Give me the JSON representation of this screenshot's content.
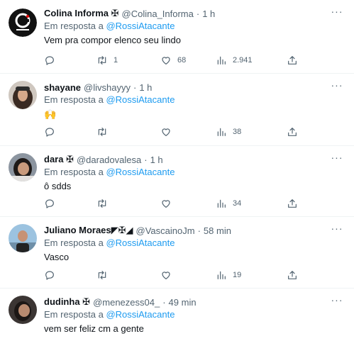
{
  "replies": [
    {
      "name": "Colina Informa ✠",
      "handle": "@Colina_Informa",
      "time": "1 h",
      "replying_prefix": "Em resposta a ",
      "replying_to": "@RossiAtacante",
      "text": "Vem pra compor elenco seu lindo",
      "retweets": "1",
      "likes": "68",
      "views": "2.941",
      "replies_count": ""
    },
    {
      "name": "shayane",
      "handle": "@livshayyy",
      "time": "1 h",
      "replying_prefix": "Em resposta a ",
      "replying_to": "@RossiAtacante",
      "text": "🙌",
      "retweets": "",
      "likes": "",
      "views": "38",
      "replies_count": ""
    },
    {
      "name": "dara ✠",
      "handle": "@daradovalesa",
      "time": "1 h",
      "replying_prefix": "Em resposta a ",
      "replying_to": "@RossiAtacante",
      "text": "ô sdds",
      "retweets": "",
      "likes": "",
      "views": "34",
      "replies_count": ""
    },
    {
      "name": "Juliano Moraes◤✠◢",
      "handle": "@VascainoJm",
      "time": "58 min",
      "replying_prefix": "Em resposta a ",
      "replying_to": "@RossiAtacante",
      "text": "Vasco",
      "retweets": "",
      "likes": "",
      "views": "19",
      "replies_count": ""
    },
    {
      "name": "dudinha ✠",
      "handle": "@menezess04_",
      "time": "49 min",
      "replying_prefix": "Em resposta a ",
      "replying_to": "@RossiAtacante",
      "text": "vem ser feliz cm a gente",
      "retweets": "",
      "likes": "",
      "views": "",
      "replies_count": ""
    }
  ],
  "dot": "·",
  "more_glyph": "···",
  "colors": {
    "link": "#1d9bf0",
    "muted": "#536471",
    "text": "#0f1419",
    "divider": "#eff3f4"
  },
  "icons": [
    "reply-icon",
    "retweet-icon",
    "like-icon",
    "views-icon",
    "share-icon",
    "more-icon"
  ]
}
